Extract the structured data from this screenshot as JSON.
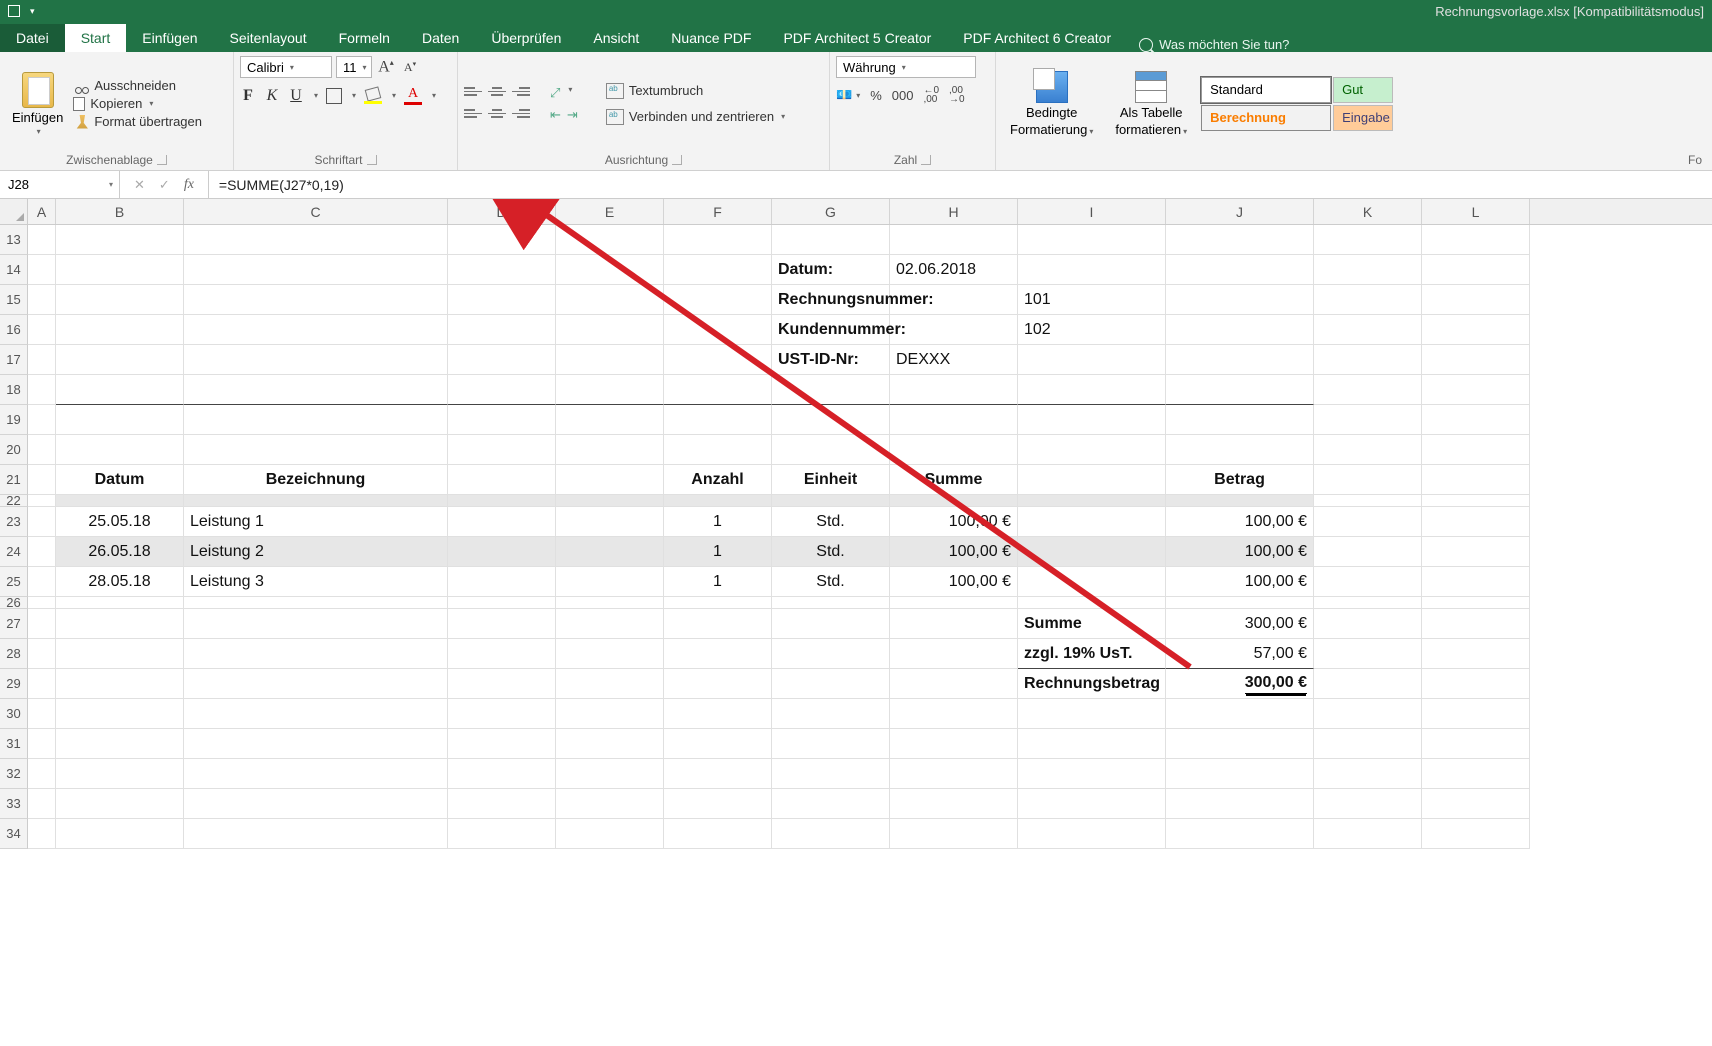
{
  "title": "Rechnungsvorlage.xlsx  [Kompatibilitätsmodus]",
  "tabs": {
    "file": "Datei",
    "start": "Start",
    "einfuegen": "Einfügen",
    "seitenlayout": "Seitenlayout",
    "formeln": "Formeln",
    "daten": "Daten",
    "ueberpruefen": "Überprüfen",
    "ansicht": "Ansicht",
    "nuance": "Nuance PDF",
    "pdfa5": "PDF Architect 5 Creator",
    "pdfa6": "PDF Architect 6 Creator"
  },
  "tellme": "Was möchten Sie tun?",
  "ribbon": {
    "clipboard": {
      "paste": "Einfügen",
      "cut": "Ausschneiden",
      "copy": "Kopieren",
      "format": "Format übertragen",
      "label": "Zwischenablage"
    },
    "font": {
      "name": "Calibri",
      "size": "11",
      "label": "Schriftart"
    },
    "align": {
      "wrap": "Textumbruch",
      "merge": "Verbinden und zentrieren",
      "label": "Ausrichtung"
    },
    "number": {
      "format": "Währung",
      "label": "Zahl"
    },
    "styles": {
      "cond1": "Bedingte",
      "cond2": "Formatierung",
      "tbl1": "Als Tabelle",
      "tbl2": "formatieren",
      "standard": "Standard",
      "gut": "Gut",
      "berech": "Berechnung",
      "eingabe": "Eingabe",
      "label": "Fo"
    }
  },
  "formula_bar": {
    "name": "J28",
    "formula": "=SUMME(J27*0,19)"
  },
  "columns": [
    "A",
    "B",
    "C",
    "D",
    "E",
    "F",
    "G",
    "H",
    "I",
    "J",
    "K",
    "L"
  ],
  "rows_left": [
    "13",
    "14",
    "15",
    "16",
    "17",
    "18",
    "19",
    "20",
    "21",
    "22",
    "23",
    "24",
    "25",
    "26",
    "27",
    "28",
    "29",
    "30",
    "31",
    "32",
    "33",
    "34"
  ],
  "meta": {
    "datum_l": "Datum:",
    "datum_v": "02.06.2018",
    "rnr_l": "Rechnungsnummer:",
    "rnr_v": "101",
    "knr_l": "Kundennummer:",
    "knr_v": "102",
    "ust_l": "UST-ID-Nr:",
    "ust_v": "DEXXX"
  },
  "hdr": {
    "datum": "Datum",
    "bez": "Bezeichnung",
    "anz": "Anzahl",
    "einh": "Einheit",
    "summe": "Summe",
    "betrag": "Betrag"
  },
  "rows": [
    {
      "d": "25.05.18",
      "b": "Leistung 1",
      "a": "1",
      "e": "Std.",
      "s": "100,00 €",
      "t": "100,00 €"
    },
    {
      "d": "26.05.18",
      "b": "Leistung 2",
      "a": "1",
      "e": "Std.",
      "s": "100,00 €",
      "t": "100,00 €"
    },
    {
      "d": "28.05.18",
      "b": "Leistung 3",
      "a": "1",
      "e": "Std.",
      "s": "100,00 €",
      "t": "100,00 €"
    }
  ],
  "totals": {
    "summe_l": "Summe",
    "summe_v": "300,00 €",
    "ust_l": "zzgl. 19% UsT.",
    "ust_v": "57,00 €",
    "rb_l": "Rechnungsbetrag",
    "rb_v": "300,00 €"
  }
}
